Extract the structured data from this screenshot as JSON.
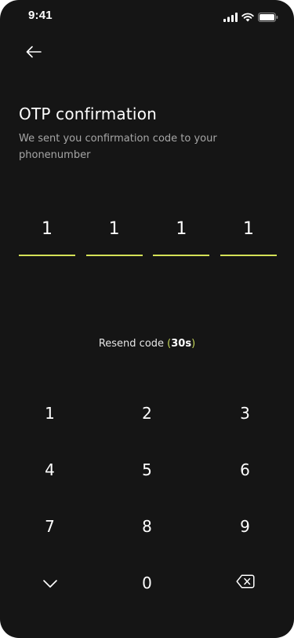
{
  "status_bar": {
    "time": "9:41"
  },
  "header": {
    "title": "OTP confirmation",
    "subtitle": "We sent you confirmation code to your phonenumber"
  },
  "otp": {
    "digits": [
      "1",
      "1",
      "1",
      "1"
    ],
    "accent_color": "#d4e157"
  },
  "resend": {
    "label": "Resend code ",
    "open_paren": "(",
    "timer": "30s",
    "close_paren": ")"
  },
  "keypad": {
    "keys": [
      "1",
      "2",
      "3",
      "4",
      "5",
      "6",
      "7",
      "8",
      "9"
    ],
    "zero": "0",
    "collapse_icon": "chevron-down-icon",
    "delete_icon": "backspace-icon"
  },
  "colors": {
    "background": "#151515",
    "text": "#ffffff",
    "muted": "#a6a6a6",
    "accent": "#d4e157"
  }
}
